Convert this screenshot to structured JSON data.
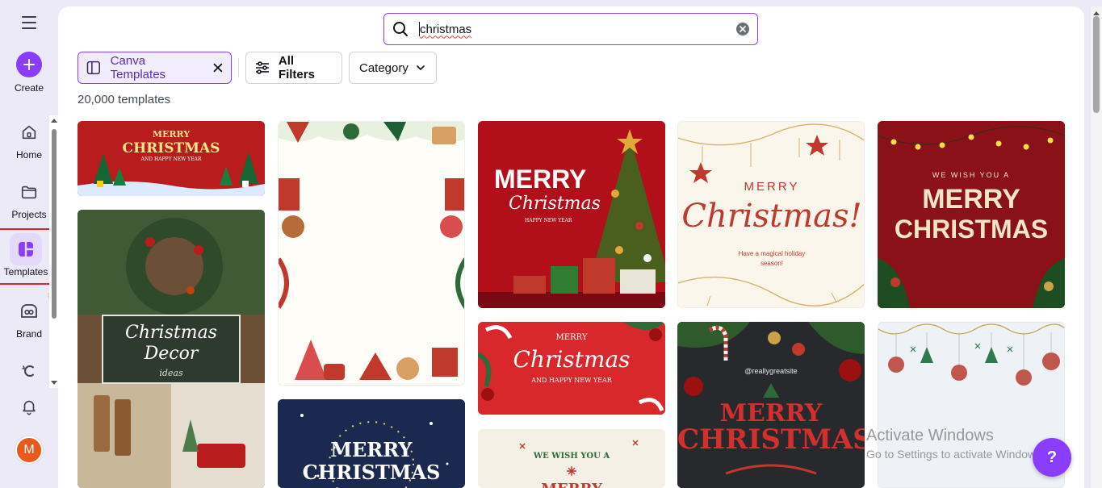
{
  "rail": {
    "create_label": "Create",
    "items": [
      {
        "label": "Home"
      },
      {
        "label": "Projects"
      },
      {
        "label": "Templates"
      },
      {
        "label": "Brand"
      }
    ],
    "avatar_initial": "M"
  },
  "search": {
    "value": "christmas"
  },
  "filters": {
    "templates_chip": "Canva Templates",
    "all_filters": "All Filters",
    "category": "Category"
  },
  "results_count": "20,000 templates",
  "cards": {
    "c1": {
      "line1": "MERRY",
      "line2": "CHRISTMAS",
      "line3": "AND HAPPY NEW YEAR"
    },
    "c2": {
      "line1": "Christmas",
      "line2": "Decor",
      "line3": "ideas"
    },
    "c4": {
      "line1": "MERRY",
      "line2": "Christmas",
      "line3": "HAPPY NEW YEAR"
    },
    "c5": {
      "line1": "MERRY",
      "line2": "Christmas!",
      "line3": "Have a magical holiday season!"
    },
    "c6": {
      "line1": "WE WISH YOU A",
      "line2": "MERRY",
      "line3": "CHRISTMAS"
    },
    "c7": {
      "line1": "MERRY",
      "line2": "Christmas",
      "line3": "AND HAPPY NEW YEAR"
    },
    "c8": {
      "line1": "@reallygreatsite",
      "line2": "MERRY",
      "line3": "CHRISTMAS"
    },
    "c10": {
      "line1": "MERRY",
      "line2": "CHRISTMAS"
    },
    "c11": {
      "line1": "WE WISH YOU A",
      "line2": "MERRY"
    }
  },
  "help_label": "?",
  "watermark": {
    "title": "Activate Windows",
    "subtitle": "Go to Settings to activate Windows."
  },
  "colors": {
    "accent": "#8b3dff",
    "selected_outline": "#e3232a"
  }
}
